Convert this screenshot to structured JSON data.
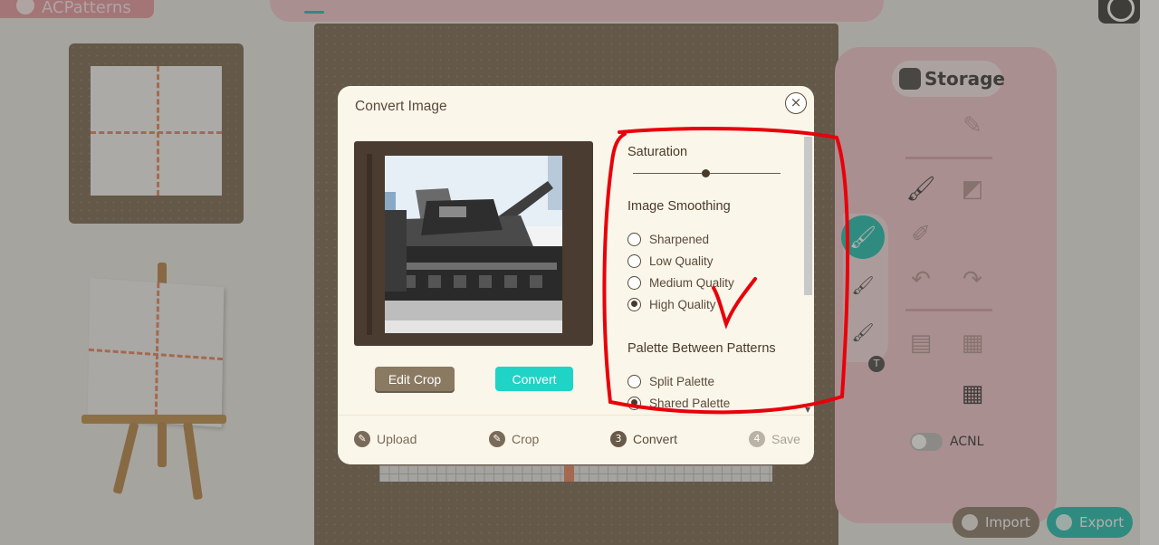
{
  "background": {
    "app_name": "ACPatterns",
    "side_panel": {
      "storage_label": "Storage"
    },
    "toggle": {
      "label": "ACNL",
      "state": "off"
    },
    "import_label": "Import",
    "export_label": "Export"
  },
  "modal": {
    "title": "Convert Image",
    "close_symbol": "×",
    "edit_crop_label": "Edit Crop",
    "convert_label": "Convert",
    "saturation": {
      "heading": "Saturation",
      "value_fraction": 0.5
    },
    "image_smoothing": {
      "heading": "Image Smoothing",
      "options": [
        "Sharpened",
        "Low Quality",
        "Medium Quality",
        "High Quality"
      ],
      "selected": "High Quality"
    },
    "palette": {
      "heading": "Palette Between Patterns",
      "options": [
        "Split Palette",
        "Shared Palette"
      ],
      "selected": "Shared Palette"
    },
    "steps": [
      {
        "label": "Upload",
        "icon": "pencil-icon",
        "state": "done"
      },
      {
        "label": "Crop",
        "icon": "pencil-icon",
        "state": "done"
      },
      {
        "label": "Convert",
        "number": "3",
        "state": "active"
      },
      {
        "label": "Save",
        "number": "4",
        "state": "disabled"
      }
    ]
  },
  "colors": {
    "accent_teal": "#1fd3c6",
    "brown_button": "#8a7a62",
    "annotation_red": "#e8000b",
    "panel_pink": "#f3c6cd"
  }
}
